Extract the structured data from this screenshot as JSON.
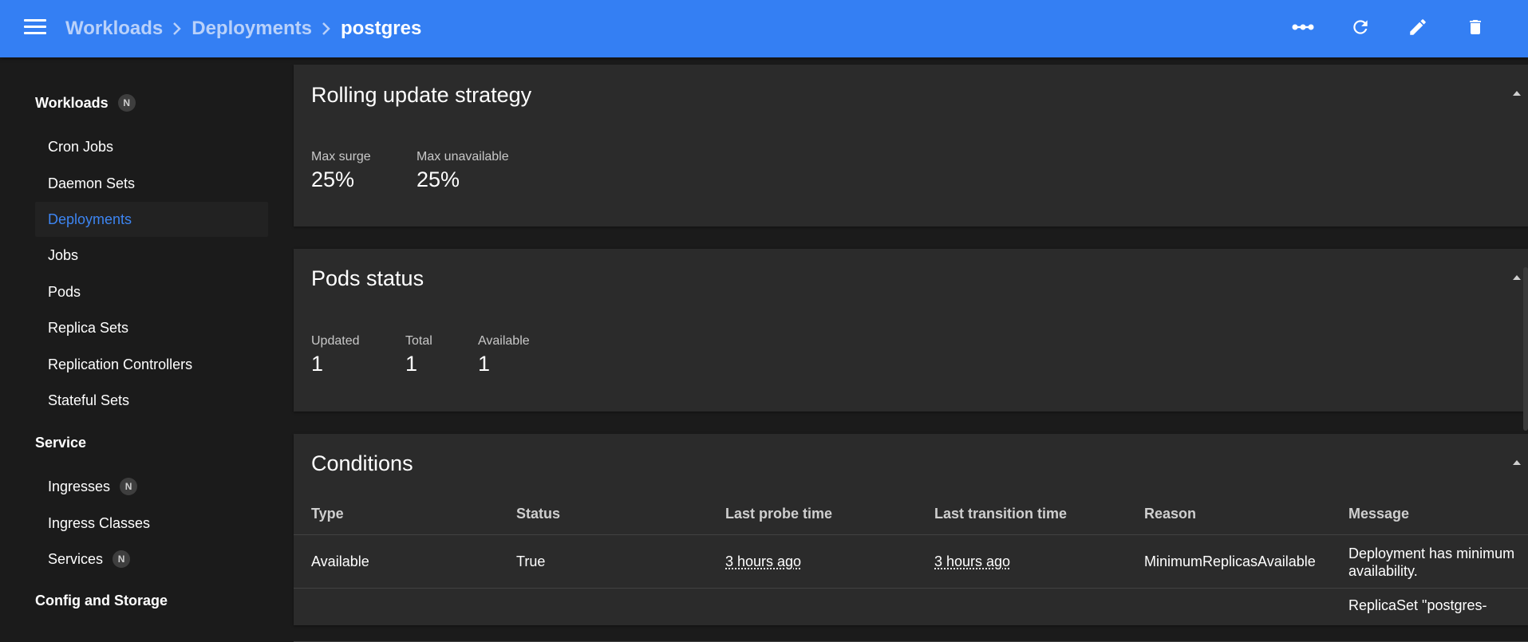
{
  "header": {
    "breadcrumbs": [
      {
        "label": "Workloads"
      },
      {
        "label": "Deployments"
      },
      {
        "label": "postgres"
      }
    ],
    "actions": [
      "scale-icon",
      "refresh-icon",
      "edit-icon",
      "delete-icon"
    ]
  },
  "sidebar": {
    "sections": [
      {
        "label": "Workloads",
        "badge": "N"
      },
      {
        "label": "Service"
      },
      {
        "label": "Config and Storage"
      }
    ],
    "workloads_items": [
      {
        "label": "Cron Jobs"
      },
      {
        "label": "Daemon Sets"
      },
      {
        "label": "Deployments"
      },
      {
        "label": "Jobs"
      },
      {
        "label": "Pods"
      },
      {
        "label": "Replica Sets"
      },
      {
        "label": "Replication Controllers"
      },
      {
        "label": "Stateful Sets"
      }
    ],
    "service_items": [
      {
        "label": "Ingresses",
        "badge": "N"
      },
      {
        "label": "Ingress Classes"
      },
      {
        "label": "Services",
        "badge": "N"
      }
    ],
    "active_item": "Deployments"
  },
  "rolling_update": {
    "title": "Rolling update strategy",
    "metrics": [
      {
        "label": "Max surge",
        "value": "25%"
      },
      {
        "label": "Max unavailable",
        "value": "25%"
      }
    ]
  },
  "pods_status": {
    "title": "Pods status",
    "metrics": [
      {
        "label": "Updated",
        "value": "1"
      },
      {
        "label": "Total",
        "value": "1"
      },
      {
        "label": "Available",
        "value": "1"
      }
    ]
  },
  "conditions": {
    "title": "Conditions",
    "columns": [
      "Type",
      "Status",
      "Last probe time",
      "Last transition time",
      "Reason",
      "Message"
    ],
    "rows": [
      {
        "type": "Available",
        "status": "True",
        "last_probe_time": "3 hours ago",
        "last_transition_time": "3 hours ago",
        "reason": "MinimumReplicasAvailable",
        "message": "Deployment has minimum availability."
      },
      {
        "type": "",
        "status": "",
        "last_probe_time": "",
        "last_transition_time": "",
        "reason": "",
        "message": "ReplicaSet \"postgres-"
      }
    ]
  },
  "colors": {
    "topbar": "#347ff3",
    "background": "#1b1b1b",
    "card": "#2b2b2b",
    "accent": "#3d85f2"
  }
}
